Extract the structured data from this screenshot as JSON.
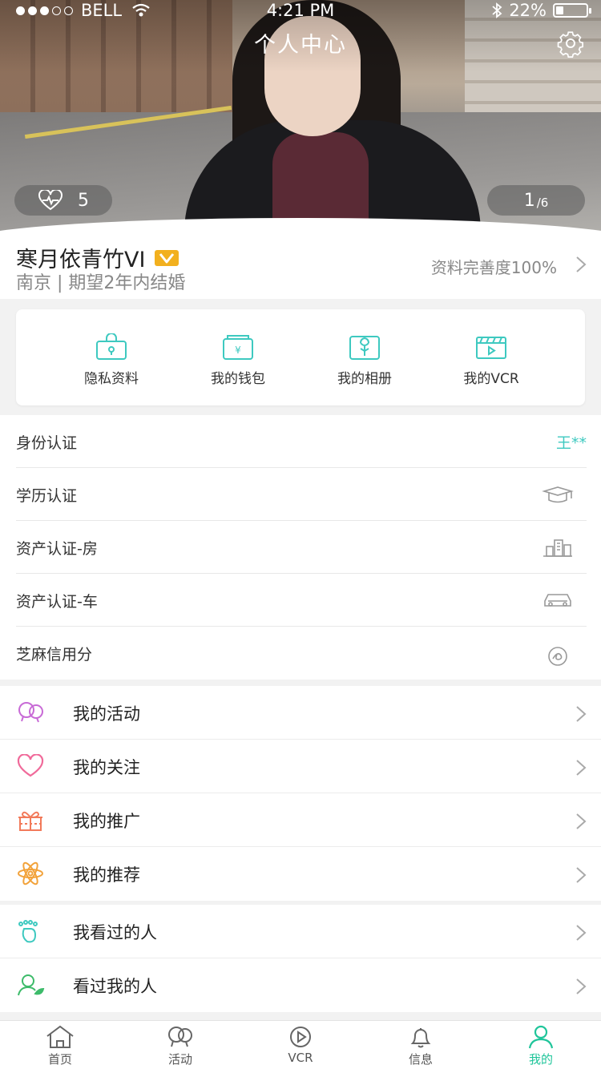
{
  "status_bar": {
    "carrier": "BELL",
    "time": "4:21 PM",
    "battery": "22%"
  },
  "header": {
    "title": "个人中心"
  },
  "photo": {
    "likes": "5",
    "index": "1",
    "total": "/6"
  },
  "profile": {
    "name": "寒月依青竹VI",
    "vip_badge": "V",
    "subtitle": "南京 | 期望2年内结婚",
    "completeness": "资料完善度100%"
  },
  "quick_actions": [
    {
      "label": "隐私资料",
      "icon": "lock-icon"
    },
    {
      "label": "我的钱包",
      "icon": "wallet-icon"
    },
    {
      "label": "我的相册",
      "icon": "album-icon"
    },
    {
      "label": "我的VCR",
      "icon": "film-icon"
    }
  ],
  "verifications": [
    {
      "label": "身份认证",
      "value": "王**"
    },
    {
      "label": "学历认证",
      "icon": "graduation-cap-icon"
    },
    {
      "label": "资产认证-房",
      "icon": "building-icon"
    },
    {
      "label": "资产认证-车",
      "icon": "car-icon"
    },
    {
      "label": "芝麻信用分",
      "icon": "sesame-credit-icon"
    }
  ],
  "menu_group_1": [
    {
      "label": "我的活动",
      "icon": "activity-bubbles-icon"
    },
    {
      "label": "我的关注",
      "icon": "heart-icon"
    },
    {
      "label": "我的推广",
      "icon": "gift-icon"
    },
    {
      "label": "我的推荐",
      "icon": "flower-icon"
    }
  ],
  "menu_group_2": [
    {
      "label": "我看过的人",
      "icon": "footprint-icon"
    },
    {
      "label": "看过我的人",
      "icon": "visitor-icon"
    }
  ],
  "tabs": [
    {
      "label": "首页",
      "icon": "home-icon"
    },
    {
      "label": "活动",
      "icon": "activity-icon"
    },
    {
      "label": "VCR",
      "icon": "play-icon"
    },
    {
      "label": "信息",
      "icon": "bell-icon"
    },
    {
      "label": "我的",
      "icon": "person-icon",
      "active": true
    }
  ],
  "colors": {
    "accent": "#1fc59a",
    "teal": "#3ec9c0",
    "vip": "#f2b01e"
  }
}
